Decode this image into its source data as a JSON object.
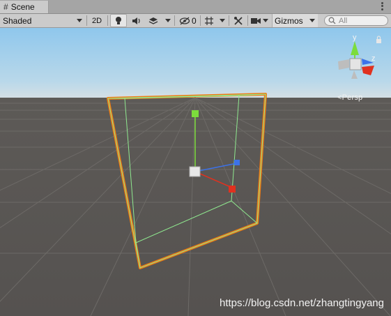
{
  "tab": {
    "title": "Scene",
    "icon": "hash-icon"
  },
  "toolbar": {
    "shading_mode": "Shaded",
    "mode_2d_label": "2D",
    "hidden_count": "0",
    "gizmos_label": "Gizmos",
    "search_placeholder": "All"
  },
  "gizmo": {
    "y_label": "y",
    "z_label": "z",
    "projection_label": "<Persp",
    "colors": {
      "y": "#7cdc3c",
      "x": "#e0311f",
      "z": "#3c72e8"
    }
  },
  "selection": {
    "outline_color": "#f07b13",
    "bounds_color": "#8fe88f"
  },
  "watermark": "https://blog.csdn.net/zhangtingyang"
}
